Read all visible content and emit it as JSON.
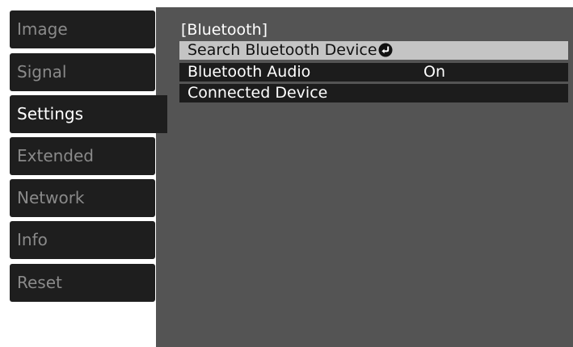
{
  "sidebar": {
    "tabs": [
      {
        "label": "Image"
      },
      {
        "label": "Signal"
      },
      {
        "label": "Settings"
      },
      {
        "label": "Extended"
      },
      {
        "label": "Network"
      },
      {
        "label": "Info"
      },
      {
        "label": "Reset"
      }
    ],
    "active_tab": "Settings"
  },
  "panel": {
    "title": "[Bluetooth]",
    "rows": [
      {
        "label": "Search Bluetooth Device",
        "value": "",
        "icon": "enter-icon",
        "selected": true
      },
      {
        "label": "Bluetooth Audio",
        "value": "On",
        "selected": false
      },
      {
        "label": "Connected Device",
        "value": "",
        "selected": false
      }
    ]
  },
  "colors": {
    "panel_background": "#545454",
    "tab_background": "#1e1e1e",
    "inactive_text": "#8a8a8a",
    "active_text": "#ffffff",
    "selected_row": "#c4c4c4",
    "row_background": "#1c1c1c"
  }
}
